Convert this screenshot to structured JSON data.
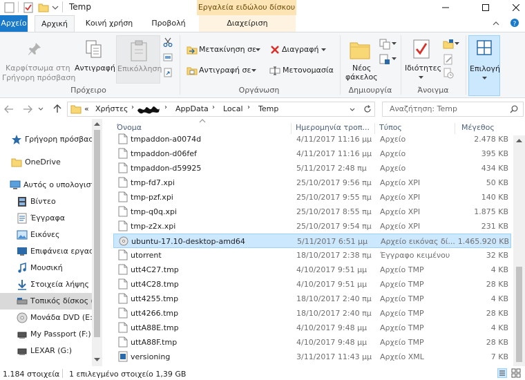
{
  "window": {
    "title": "Temp",
    "contextual_tab_group": "Εργαλεία ειδώλου δίσκου"
  },
  "tabs": [
    {
      "label": "Αρχείο"
    },
    {
      "label": "Αρχική"
    },
    {
      "label": "Κοινή χρήση"
    },
    {
      "label": "Προβολή"
    },
    {
      "label": "Διαχείριση"
    }
  ],
  "ribbon": {
    "clipboard": {
      "pin_line1": "Καρφίτσωμα στη",
      "pin_line2": "Γρήγορη πρόσβαση",
      "copy": "Αντιγραφή",
      "paste": "Επικόλληση",
      "group": "Πρόχειρο"
    },
    "organize": {
      "move_to": "Μετακίνηση σε",
      "copy_to": "Αντιγραφή σε",
      "delete": "Διαγραφή",
      "rename": "Μετονομασία",
      "group": "Οργάνωση"
    },
    "new": {
      "folder_line1": "Νέος",
      "folder_line2": "φάκελος",
      "group": "Δημιουργία"
    },
    "open": {
      "properties": "Ιδιότητες",
      "group": "Άνοιγμα"
    },
    "select": {
      "label": "Επιλογή"
    }
  },
  "address": {
    "prefix": "«",
    "crumbs": [
      "Χρήστες",
      "AppData",
      "Local",
      "Temp"
    ],
    "search_placeholder": "Αναζήτηση: Temp"
  },
  "nav": [
    {
      "label": "Γρήγορη πρόσβαση"
    },
    {
      "label": "OneDrive"
    },
    {
      "label": "Αυτός ο υπολογιστής"
    },
    {
      "label": "Βίντεο"
    },
    {
      "label": "Έγγραφα"
    },
    {
      "label": "Εικόνες"
    },
    {
      "label": "Επιφάνεια εργασίας"
    },
    {
      "label": "Μουσική"
    },
    {
      "label": "Στοιχεία λήψης"
    },
    {
      "label": "Τοπικός δίσκος (C:)"
    },
    {
      "label": "Μονάδα DVD (E:)"
    },
    {
      "label": "My Passport (F:)"
    },
    {
      "label": "LEXAR (G:)"
    }
  ],
  "columns": {
    "name": "Όνομα",
    "date": "Ημερομηνία τροπ...",
    "type": "Τύπος",
    "size": "Μέγεθος"
  },
  "files": [
    {
      "name": "tmpaddon-a0074d",
      "date": "4/11/2017 11:16 μμ",
      "type": "Αρχείο",
      "size": "2.478 KB"
    },
    {
      "name": "tmpaddon-d06fef",
      "date": "4/11/2017 11:16 μμ",
      "type": "Αρχείο",
      "size": "395 KB"
    },
    {
      "name": "tmpaddon-d59925",
      "date": "5/11/2017 2:48 πμ",
      "type": "Αρχείο",
      "size": "434 KB"
    },
    {
      "name": "tmp-fd7.xpi",
      "date": "25/10/2017 9:56 πμ",
      "type": "Αρχείο XPI",
      "size": "50 KB"
    },
    {
      "name": "tmp-pzf.xpi",
      "date": "25/10/2017 9:55 πμ",
      "type": "Αρχείο XPI",
      "size": "140 KB"
    },
    {
      "name": "tmp-q0q.xpi",
      "date": "25/10/2017 8:55 πμ",
      "type": "Αρχείο XPI",
      "size": "1.875 KB"
    },
    {
      "name": "tmp-z2x.xpi",
      "date": "25/10/2017 9:54 πμ",
      "type": "Αρχείο XPI",
      "size": "231 KB"
    },
    {
      "name": "ubuntu-17.10-desktop-amd64",
      "date": "5/11/2017 6:51 μμ",
      "type": "Αρχείο εικόνας δί...",
      "size": "1.465.920 KB"
    },
    {
      "name": "utorrent",
      "date": "18/10/2017 2:38 πμ",
      "type": "Έγγραφο κειμένου",
      "size": "32 KB"
    },
    {
      "name": "utt4C27.tmp",
      "date": "4/10/2017 9:51 μμ",
      "type": "Αρχείο TMP",
      "size": "4 KB"
    },
    {
      "name": "utt4C28.tmp",
      "date": "4/10/2017 9:51 μμ",
      "type": "Αρχείο TMP",
      "size": "28 KB"
    },
    {
      "name": "utt4255.tmp",
      "date": "18/10/2017 2:40 πμ",
      "type": "Αρχείο TMP",
      "size": "4 KB"
    },
    {
      "name": "utt4266.tmp",
      "date": "18/10/2017 2:40 πμ",
      "type": "Αρχείο TMP",
      "size": "28 KB"
    },
    {
      "name": "uttA88E.tmp",
      "date": "4/10/2017 9:48 μμ",
      "type": "Αρχείο TMP",
      "size": "4 KB"
    },
    {
      "name": "uttA88F.tmp",
      "date": "4/10/2017 9:48 μμ",
      "type": "Αρχείο TMP",
      "size": "28 KB"
    },
    {
      "name": "versioning",
      "date": "3/11/2017 11:43 μμ",
      "type": "Αρχείο XML",
      "size": "7 KB"
    }
  ],
  "status": {
    "count": "1.184 στοιχεία",
    "selection": "1 επιλεγμένο στοιχείο 1,39 GB"
  },
  "colors": {
    "accent": "#1979ca",
    "selection": "#cce8ff",
    "contextual": "#fce4b5"
  }
}
